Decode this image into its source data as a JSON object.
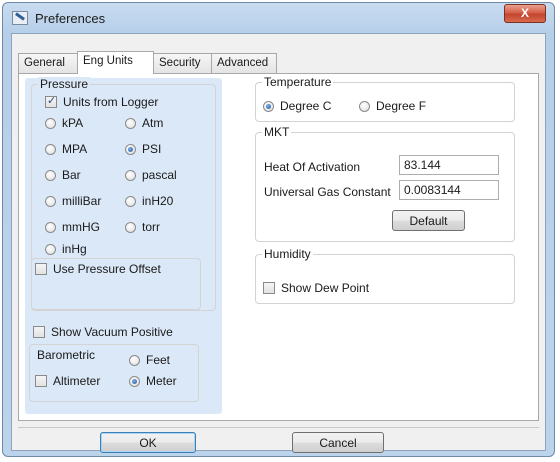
{
  "window": {
    "title": "Preferences",
    "close_glyph": "X"
  },
  "tabs": [
    {
      "label": "General",
      "active": false
    },
    {
      "label": "Eng Units",
      "active": true
    },
    {
      "label": "Security",
      "active": false
    },
    {
      "label": "Advanced",
      "active": false
    }
  ],
  "pressure": {
    "title": "Pressure",
    "units_from_logger": {
      "label": "Units from Logger",
      "checked": true
    },
    "units": [
      {
        "label": "kPA",
        "selected": false
      },
      {
        "label": "Atm",
        "selected": false
      },
      {
        "label": "MPA",
        "selected": false
      },
      {
        "label": "PSI",
        "selected": true
      },
      {
        "label": "Bar",
        "selected": false
      },
      {
        "label": "pascal",
        "selected": false
      },
      {
        "label": "milliBar",
        "selected": false
      },
      {
        "label": "inH20",
        "selected": false
      },
      {
        "label": "mmHG",
        "selected": false
      },
      {
        "label": "torr",
        "selected": false
      },
      {
        "label": "inHg",
        "selected": false
      }
    ],
    "use_offset": {
      "label": "Use Pressure Offset",
      "checked": false
    },
    "show_vacuum": {
      "label": "Show Vacuum Positive",
      "checked": false
    },
    "barometric": {
      "title": "Barometric",
      "altimeter": {
        "label": "Altimeter",
        "checked": false
      },
      "feet": {
        "label": "Feet",
        "selected": false
      },
      "meter": {
        "label": "Meter",
        "selected": true
      }
    }
  },
  "temperature": {
    "title": "Temperature",
    "degree_c": {
      "label": "Degree C",
      "selected": true
    },
    "degree_f": {
      "label": "Degree F",
      "selected": false
    }
  },
  "mkt": {
    "title": "MKT",
    "heat_label": "Heat Of Activation",
    "heat_value": "83.144",
    "gas_label": "Universal Gas Constant",
    "gas_value": "0.0083144",
    "default_label": "Default"
  },
  "humidity": {
    "title": "Humidity",
    "show_dew_point": {
      "label": "Show Dew Point",
      "checked": false
    }
  },
  "footer": {
    "ok_label": "OK",
    "cancel_label": "Cancel"
  },
  "colors": {
    "title_bar": "#bcd3ec",
    "close_button": "#c4442e",
    "pressure_panel": "#dbe8f7",
    "focus_border": "#3c7fb1"
  }
}
